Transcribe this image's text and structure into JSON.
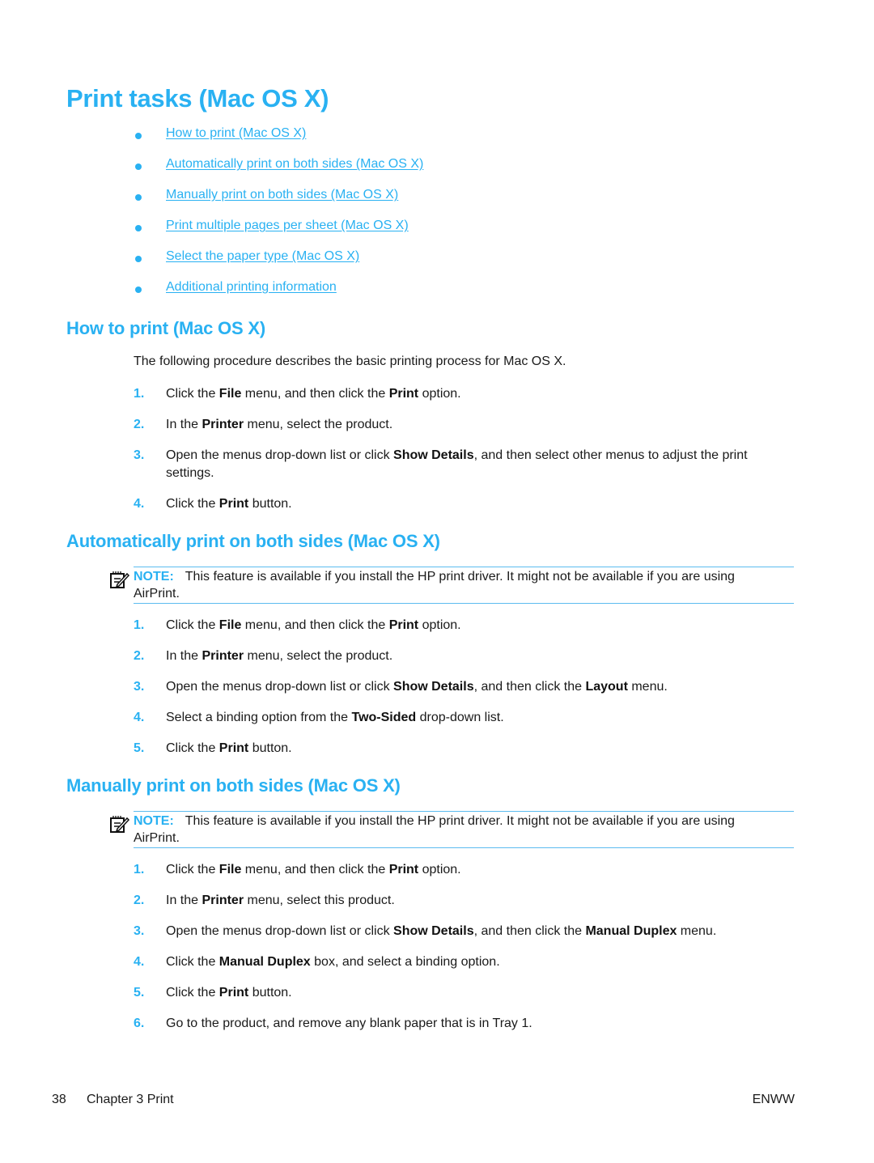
{
  "page_title": "Print tasks (Mac OS X)",
  "toc": [
    "How to print (Mac OS X)",
    "Automatically print on both sides (Mac OS X)",
    "Manually print on both sides (Mac OS X)",
    "Print multiple pages per sheet (Mac OS X)",
    "Select the paper type (Mac OS X)",
    "Additional printing information"
  ],
  "sections": [
    {
      "title": "How to print (Mac OS X)",
      "intro": "The following procedure describes the basic printing process for Mac OS X.",
      "steps": [
        {
          "num": "1.",
          "parts": [
            [
              "Click the ",
              false
            ],
            [
              "File",
              true
            ],
            [
              " menu, and then click the ",
              false
            ],
            [
              "Print",
              true
            ],
            [
              " option.",
              false
            ]
          ]
        },
        {
          "num": "2.",
          "parts": [
            [
              "In the ",
              false
            ],
            [
              "Printer",
              true
            ],
            [
              " menu, select the product.",
              false
            ]
          ]
        },
        {
          "num": "3.",
          "parts": [
            [
              "Open the menus drop-down list or click ",
              false
            ],
            [
              "Show Details",
              true
            ],
            [
              ", and then select other menus to adjust the print settings.",
              false
            ]
          ]
        },
        {
          "num": "4.",
          "parts": [
            [
              "Click the ",
              false
            ],
            [
              "Print",
              true
            ],
            [
              " button.",
              false
            ]
          ]
        }
      ]
    },
    {
      "title": "Automatically print on both sides (Mac OS X)",
      "note": {
        "label": "NOTE:",
        "text": "This feature is available if you install the HP print driver. It might not be available if you are using AirPrint."
      },
      "steps": [
        {
          "num": "1.",
          "parts": [
            [
              "Click the ",
              false
            ],
            [
              "File",
              true
            ],
            [
              " menu, and then click the ",
              false
            ],
            [
              "Print",
              true
            ],
            [
              " option.",
              false
            ]
          ]
        },
        {
          "num": "2.",
          "parts": [
            [
              "In the ",
              false
            ],
            [
              "Printer",
              true
            ],
            [
              " menu, select the product.",
              false
            ]
          ]
        },
        {
          "num": "3.",
          "parts": [
            [
              "Open the menus drop-down list or click ",
              false
            ],
            [
              "Show Details",
              true
            ],
            [
              ", and then click the ",
              false
            ],
            [
              "Layout",
              true
            ],
            [
              " menu.",
              false
            ]
          ]
        },
        {
          "num": "4.",
          "parts": [
            [
              "Select a binding option from the ",
              false
            ],
            [
              "Two-Sided",
              true
            ],
            [
              " drop-down list.",
              false
            ]
          ]
        },
        {
          "num": "5.",
          "parts": [
            [
              "Click the ",
              false
            ],
            [
              "Print",
              true
            ],
            [
              " button.",
              false
            ]
          ]
        }
      ]
    },
    {
      "title": "Manually print on both sides (Mac OS X)",
      "note": {
        "label": "NOTE:",
        "text": "This feature is available if you install the HP print driver. It might not be available if you are using AirPrint."
      },
      "steps": [
        {
          "num": "1.",
          "parts": [
            [
              "Click the ",
              false
            ],
            [
              "File",
              true
            ],
            [
              " menu, and then click the ",
              false
            ],
            [
              "Print",
              true
            ],
            [
              " option.",
              false
            ]
          ]
        },
        {
          "num": "2.",
          "parts": [
            [
              "In the ",
              false
            ],
            [
              "Printer",
              true
            ],
            [
              " menu, select this product.",
              false
            ]
          ]
        },
        {
          "num": "3.",
          "parts": [
            [
              "Open the menus drop-down list or click ",
              false
            ],
            [
              "Show Details",
              true
            ],
            [
              ", and then click the ",
              false
            ],
            [
              "Manual Duplex",
              true
            ],
            [
              " menu.",
              false
            ]
          ]
        },
        {
          "num": "4.",
          "parts": [
            [
              "Click the ",
              false
            ],
            [
              "Manual Duplex",
              true
            ],
            [
              " box, and select a binding option.",
              false
            ]
          ]
        },
        {
          "num": "5.",
          "parts": [
            [
              "Click the ",
              false
            ],
            [
              "Print",
              true
            ],
            [
              " button.",
              false
            ]
          ]
        },
        {
          "num": "6.",
          "parts": [
            [
              "Go to the product, and remove any blank paper that is in Tray 1.",
              false
            ]
          ]
        }
      ]
    }
  ],
  "footer": {
    "page_number": "38",
    "chapter": "Chapter 3  Print",
    "locale": "ENWW"
  },
  "colors": {
    "accent": "#29b1f2",
    "note_rule": "#5cbcf0",
    "text": "#1a1a1a"
  }
}
